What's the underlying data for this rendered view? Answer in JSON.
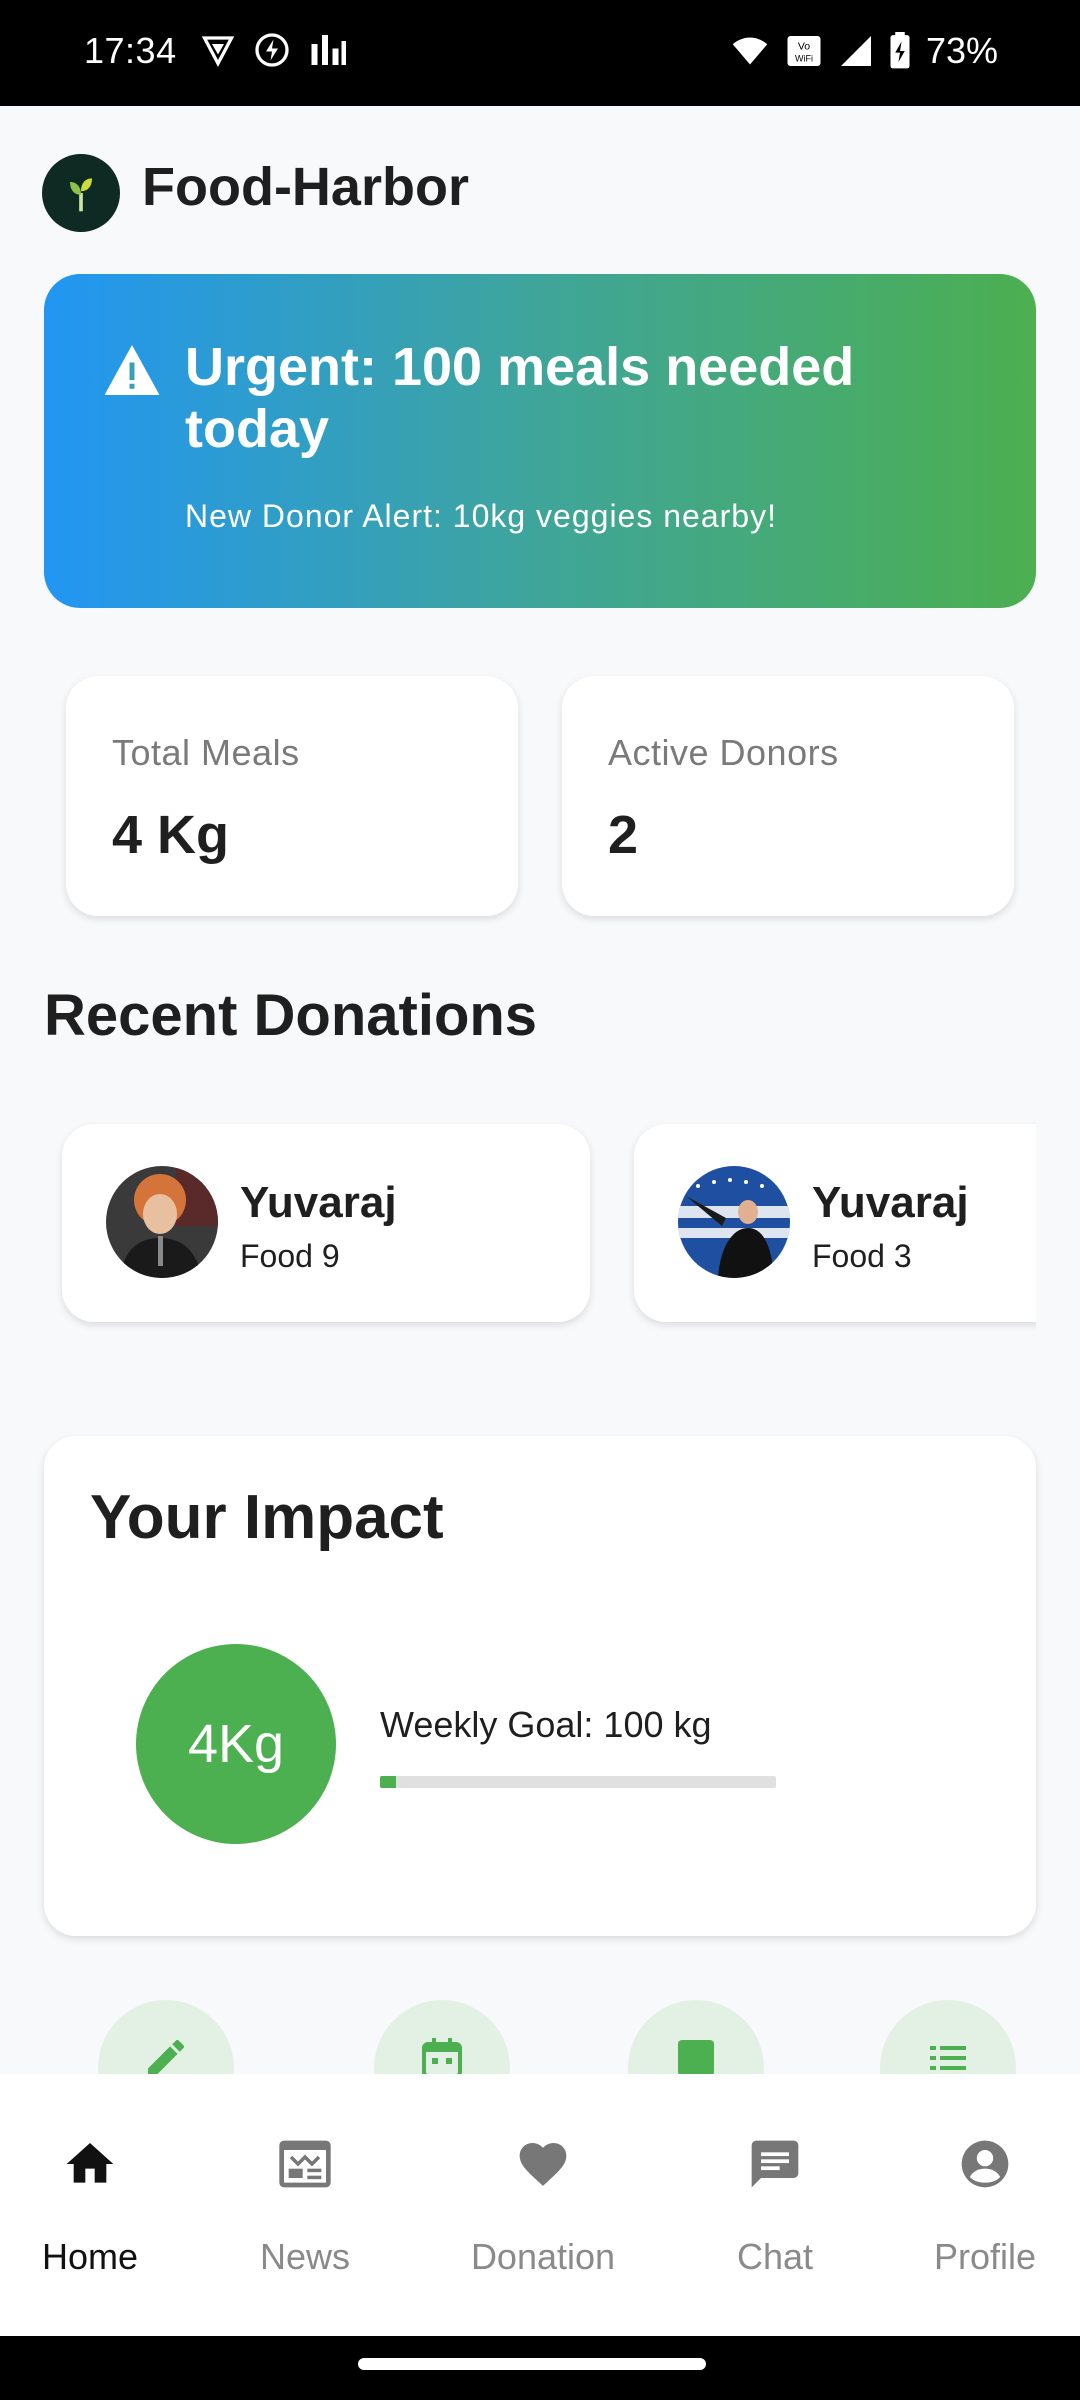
{
  "status_bar": {
    "time": "17:34",
    "battery": "73%",
    "icons_left": [
      "vpn-icon",
      "bolt-icon",
      "signal-bars-icon"
    ],
    "icons_right": [
      "wifi-icon",
      "vowifi-icon",
      "cell-signal-icon",
      "battery-icon"
    ]
  },
  "header": {
    "app_name": "Food-Harbor",
    "logo_icon": "sprout-icon"
  },
  "banner": {
    "title": "Urgent: 100 meals needed today",
    "subtitle": "New Donor Alert: 10kg veggies nearby!",
    "icon": "warning-icon"
  },
  "stats": [
    {
      "label": "Total Meals",
      "value": "4 Kg"
    },
    {
      "label": "Active Donors",
      "value": "2"
    }
  ],
  "recent": {
    "title": "Recent Donations",
    "items": [
      {
        "name": "Yuvaraj",
        "food": "Food 9"
      },
      {
        "name": "Yuvaraj",
        "food": "Food 3"
      }
    ]
  },
  "impact": {
    "title": "Your Impact",
    "amount": "4Kg",
    "goal_text": "Weekly Goal: 100 kg",
    "progress_fraction": 0.04
  },
  "quick_actions": [
    "edit-icon",
    "calendar-icon",
    "square-icon",
    "list-icon"
  ],
  "nav": {
    "items": [
      {
        "label": "Home",
        "icon": "home-icon",
        "active": true
      },
      {
        "label": "News",
        "icon": "news-icon",
        "active": false
      },
      {
        "label": "Donation",
        "icon": "heart-icon",
        "active": false
      },
      {
        "label": "Chat",
        "icon": "chat-icon",
        "active": false
      },
      {
        "label": "Profile",
        "icon": "profile-icon",
        "active": false
      }
    ]
  },
  "colors": {
    "primary_green": "#4caf50",
    "banner_start": "#2196f3",
    "banner_end": "#4caf50",
    "quick_action_bg": "#e3f1e4"
  }
}
